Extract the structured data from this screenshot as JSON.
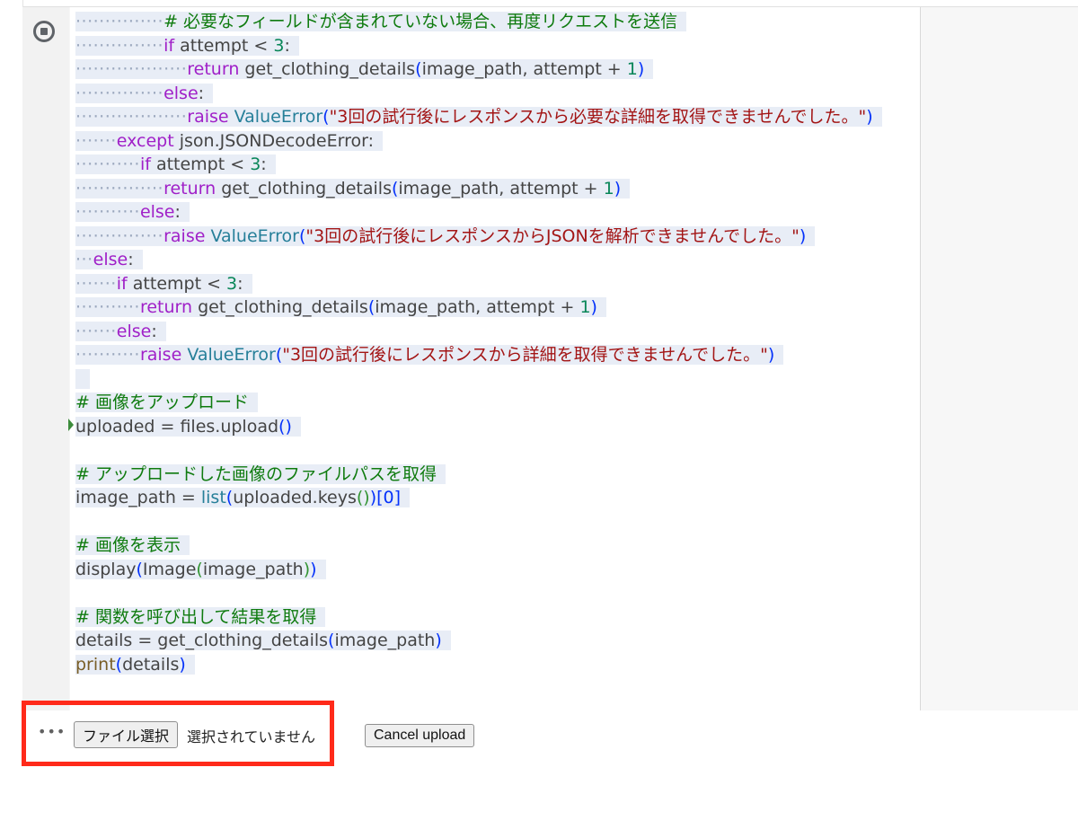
{
  "code_lines": [
    {
      "indent": "···············",
      "tokens": [
        [
          "cm",
          "# 必要なフィールドが含まれていない場合、再度リクエストを送信"
        ]
      ]
    },
    {
      "indent": "···············",
      "tokens": [
        [
          "kw",
          "if"
        ],
        [
          "op",
          " attempt < "
        ],
        [
          "num",
          "3"
        ],
        [
          "op",
          ":"
        ]
      ]
    },
    {
      "indent": "···················",
      "tokens": [
        [
          "kw",
          "return"
        ],
        [
          "op",
          " get_clothing_details"
        ],
        [
          "br",
          "("
        ],
        [
          "op",
          "image_path, attempt + "
        ],
        [
          "num",
          "1"
        ],
        [
          "br",
          ")"
        ]
      ]
    },
    {
      "indent": "···············",
      "tokens": [
        [
          "kw",
          "else"
        ],
        [
          "op",
          ":"
        ]
      ]
    },
    {
      "indent": "···················",
      "tokens": [
        [
          "kw",
          "raise"
        ],
        [
          "op",
          " "
        ],
        [
          "bi",
          "ValueError"
        ],
        [
          "br",
          "("
        ],
        [
          "str",
          "\"3回の試行後にレスポンスから必要な詳細を取得できませんでした。\""
        ],
        [
          "br",
          ")"
        ]
      ]
    },
    {
      "indent": "·······",
      "tokens": [
        [
          "kw",
          "except"
        ],
        [
          "op",
          " json.JSONDecodeError:"
        ]
      ]
    },
    {
      "indent": "···········",
      "tokens": [
        [
          "kw",
          "if"
        ],
        [
          "op",
          " attempt < "
        ],
        [
          "num",
          "3"
        ],
        [
          "op",
          ":"
        ]
      ]
    },
    {
      "indent": "···············",
      "tokens": [
        [
          "kw",
          "return"
        ],
        [
          "op",
          " get_clothing_details"
        ],
        [
          "br",
          "("
        ],
        [
          "op",
          "image_path, attempt + "
        ],
        [
          "num",
          "1"
        ],
        [
          "br",
          ")"
        ]
      ]
    },
    {
      "indent": "···········",
      "tokens": [
        [
          "kw",
          "else"
        ],
        [
          "op",
          ":"
        ]
      ]
    },
    {
      "indent": "···············",
      "tokens": [
        [
          "kw",
          "raise"
        ],
        [
          "op",
          " "
        ],
        [
          "bi",
          "ValueError"
        ],
        [
          "br",
          "("
        ],
        [
          "str",
          "\"3回の試行後にレスポンスからJSONを解析できませんでした。\""
        ],
        [
          "br",
          ")"
        ]
      ]
    },
    {
      "indent": "···",
      "tokens": [
        [
          "kw",
          "else"
        ],
        [
          "op",
          ":"
        ]
      ]
    },
    {
      "indent": "·······",
      "tokens": [
        [
          "kw",
          "if"
        ],
        [
          "op",
          " attempt < "
        ],
        [
          "num",
          "3"
        ],
        [
          "op",
          ":"
        ]
      ]
    },
    {
      "indent": "···········",
      "tokens": [
        [
          "kw",
          "return"
        ],
        [
          "op",
          " get_clothing_details"
        ],
        [
          "br",
          "("
        ],
        [
          "op",
          "image_path, attempt + "
        ],
        [
          "num",
          "1"
        ],
        [
          "br",
          ")"
        ]
      ]
    },
    {
      "indent": "·······",
      "tokens": [
        [
          "kw",
          "else"
        ],
        [
          "op",
          ":"
        ]
      ]
    },
    {
      "indent": "···········",
      "tokens": [
        [
          "kw",
          "raise"
        ],
        [
          "op",
          " "
        ],
        [
          "bi",
          "ValueError"
        ],
        [
          "br",
          "("
        ],
        [
          "str",
          "\"3回の試行後にレスポンスから詳細を取得できませんでした。\""
        ],
        [
          "br",
          ")"
        ]
      ]
    },
    {
      "indent": "",
      "tokens": [
        [
          "op",
          " "
        ]
      ]
    },
    {
      "indent": "",
      "tokens": [
        [
          "cm",
          "# 画像をアップロード"
        ]
      ]
    },
    {
      "indent": "",
      "tokens": [
        [
          "op",
          "uploaded = files.upload"
        ],
        [
          "br",
          "()"
        ]
      ]
    },
    {
      "indent": "",
      "tokens": []
    },
    {
      "indent": "",
      "tokens": [
        [
          "cm",
          "# アップロードした画像のファイルパスを取得"
        ]
      ]
    },
    {
      "indent": "",
      "tokens": [
        [
          "op",
          "image_path = "
        ],
        [
          "bi",
          "list"
        ],
        [
          "br",
          "("
        ],
        [
          "op",
          "uploaded.keys"
        ],
        [
          "br2",
          "()"
        ],
        [
          "br",
          ")"
        ],
        [
          "br",
          "[0]"
        ]
      ]
    },
    {
      "indent": "",
      "tokens": []
    },
    {
      "indent": "",
      "tokens": [
        [
          "cm",
          "# 画像を表示"
        ]
      ]
    },
    {
      "indent": "",
      "tokens": [
        [
          "op",
          "display"
        ],
        [
          "br",
          "("
        ],
        [
          "op",
          "Image"
        ],
        [
          "br2",
          "("
        ],
        [
          "op",
          "image_path"
        ],
        [
          "br2",
          ")"
        ],
        [
          "br",
          ")"
        ]
      ]
    },
    {
      "indent": "",
      "tokens": []
    },
    {
      "indent": "",
      "tokens": [
        [
          "cm",
          "# 関数を呼び出して結果を取得"
        ]
      ]
    },
    {
      "indent": "",
      "tokens": [
        [
          "op",
          "details = get_clothing_details"
        ],
        [
          "br",
          "("
        ],
        [
          "op",
          "image_path"
        ],
        [
          "br",
          ")"
        ]
      ]
    },
    {
      "indent": "",
      "tokens": [
        [
          "fn",
          "print"
        ],
        [
          "br",
          "("
        ],
        [
          "op",
          "details"
        ],
        [
          "br",
          ")"
        ]
      ]
    }
  ],
  "output": {
    "menu_label": "•••",
    "file_button_label": "ファイル選択",
    "file_status": "選択されていません",
    "cancel_button_label": "Cancel upload"
  },
  "colors": {
    "highlight_box": "#ff2a1a",
    "keyword": "#a020c8",
    "comment": "#0f7b0f",
    "string": "#a31515",
    "number": "#098658",
    "builtin": "#267f99"
  },
  "icons": {
    "run": "stop-circle-icon",
    "menu": "more-horiz-icon",
    "fold": "fold-arrow-icon"
  }
}
